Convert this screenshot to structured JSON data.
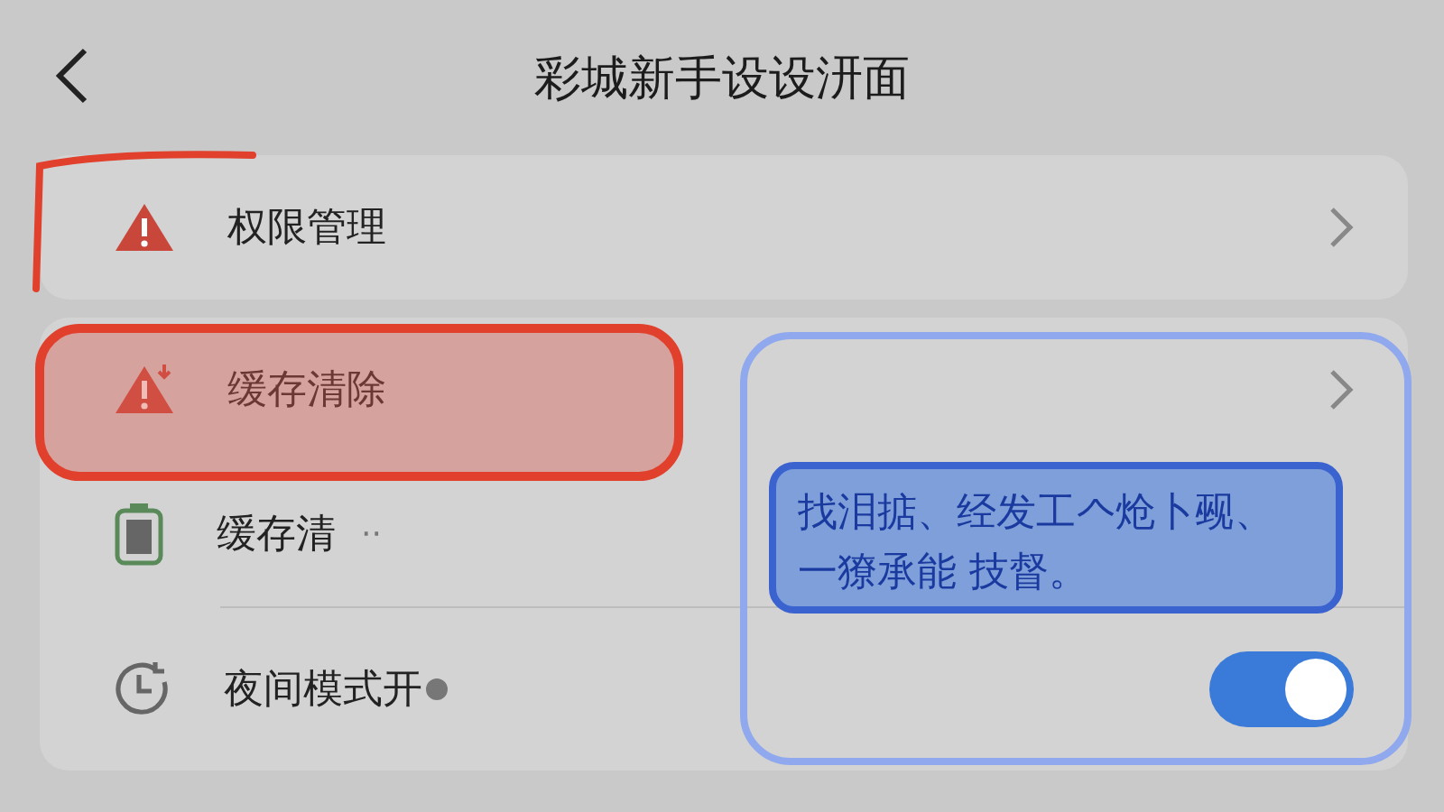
{
  "header": {
    "title": "彩城新手设设汧面"
  },
  "groups": [
    {
      "items": [
        {
          "kind": "link",
          "label": "权限管理"
        }
      ]
    },
    {
      "items": [
        {
          "kind": "link",
          "label": "缓存清除"
        },
        {
          "kind": "text",
          "label": "缓存清",
          "suffix": "··"
        },
        {
          "kind": "toggle",
          "label": "夜间模式开",
          "on": true
        }
      ]
    }
  ],
  "annotations": [
    {
      "kind": "bracket"
    },
    {
      "kind": "highlight"
    },
    {
      "kind": "outline"
    },
    {
      "kind": "callout",
      "lines": [
        "找泪掂、经发工𠆢炝卜觋、",
        "一獠承能 技督。"
      ]
    }
  ]
}
